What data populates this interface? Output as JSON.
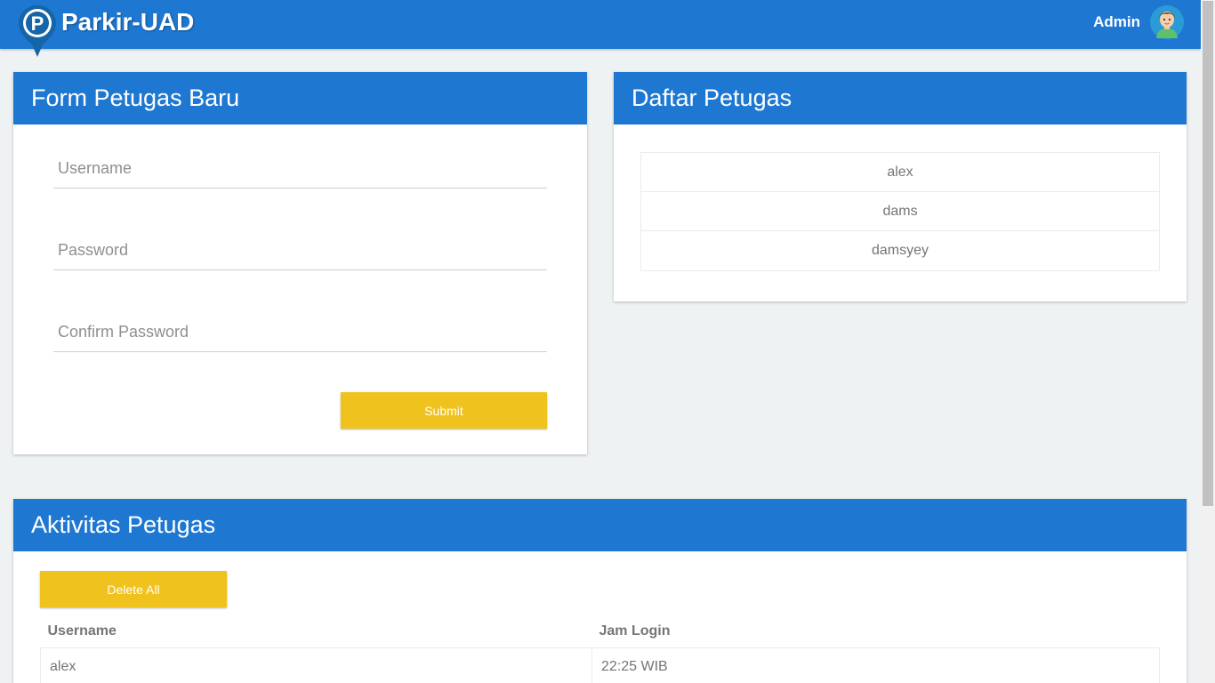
{
  "navbar": {
    "brand": "Parkir-UAD",
    "logo_letter": "P",
    "user_label": "Admin",
    "logo_icon": "parking-pin-icon",
    "avatar_icon": "user-avatar-icon"
  },
  "form_card": {
    "title": "Form Petugas Baru",
    "username_placeholder": "Username",
    "password_placeholder": "Password",
    "confirm_placeholder": "Confirm Password",
    "submit_label": "Submit"
  },
  "list_card": {
    "title": "Daftar Petugas",
    "officers": [
      "alex",
      "dams",
      "damsyey"
    ]
  },
  "activity_card": {
    "title": "Aktivitas Petugas",
    "delete_label": "Delete All",
    "columns": [
      "Username",
      "Jam Login"
    ],
    "rows": [
      {
        "username": "alex",
        "login_time": "22:25 WIB"
      }
    ]
  },
  "colors": {
    "primary": "#1e78d2",
    "accent": "#f0c21d",
    "background": "#eff2f3"
  }
}
